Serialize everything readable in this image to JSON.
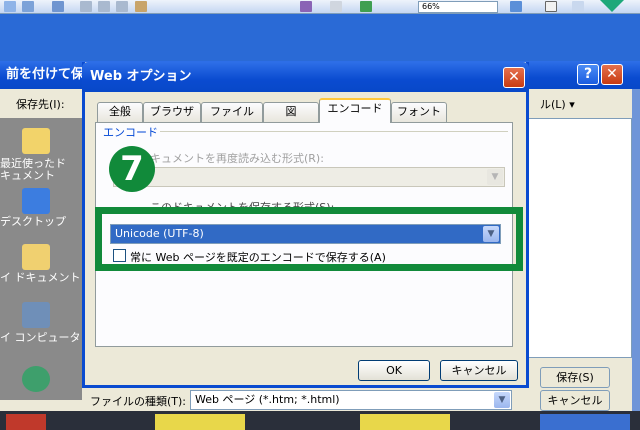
{
  "toolbar": {
    "zoom": "66%"
  },
  "save_dialog": {
    "title": "前を付けて保存",
    "save_in_label": "保存先(I):",
    "places": [
      "最近使ったド\nキュメント",
      "デスクトップ",
      "イ ドキュメント",
      "イ コンピュータ",
      ""
    ],
    "view_label": "ル(L) ▾",
    "save_button": "保存(S)",
    "cancel_button": "キャンセル",
    "filetype_label": "ファイルの種類(T):",
    "filetype_value": "Web ページ (*.htm; *.html)"
  },
  "web_options": {
    "title": "Web オプション",
    "tabs": [
      "全般",
      "ブラウザ",
      "ファイル",
      "図",
      "エンコード",
      "フォント"
    ],
    "active_tab": "エンコード",
    "group_label": "エンコード",
    "reload_label": "キュメントを再度読み込む形式(R):",
    "save_as_label": "このドキュメントを保存する形式(S):",
    "encoding_value": "Unicode (UTF-8)",
    "default_encoding_checkbox": "常に Web ページを既定のエンコードで保存する(A)",
    "ok_button": "OK",
    "cancel_button": "キャンセル"
  },
  "annotation": {
    "step_number": "7",
    "highlight_color": "#118a3a"
  }
}
